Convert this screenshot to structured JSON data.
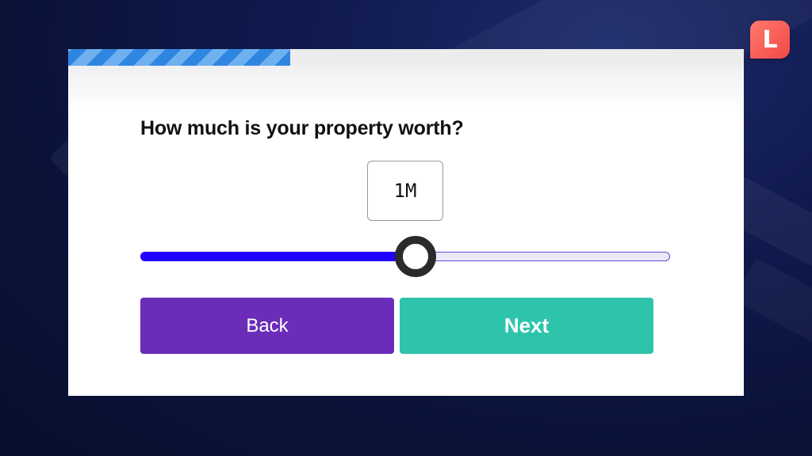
{
  "brand": {
    "logo_letter": "L",
    "logo_color": "#f04848"
  },
  "progress": {
    "fraction": 0.329,
    "fill_color": "#2f86e0"
  },
  "question": {
    "text": "How much is your property worth?"
  },
  "value_display": {
    "number": "1",
    "unit": "M"
  },
  "slider": {
    "fraction": 0.52,
    "fill_color": "#2100ff"
  },
  "buttons": {
    "back_label": "Back",
    "next_label": "Next",
    "back_color": "#6b2db8",
    "next_color": "#2ec4ac"
  }
}
